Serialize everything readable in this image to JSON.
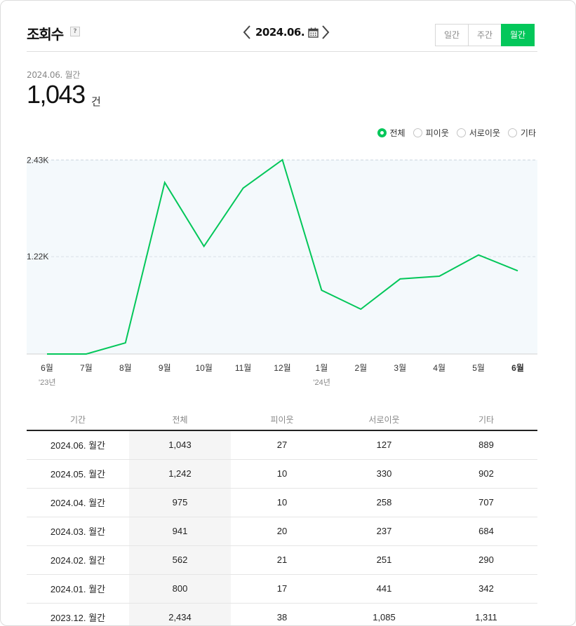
{
  "header": {
    "title": "조회수",
    "help_label": "?",
    "date_label": "2024.06.",
    "period_buttons": [
      "일간",
      "주간",
      "월간"
    ],
    "active_period": "월간"
  },
  "summary": {
    "subtitle": "2024.06. 월간",
    "value": "1,043",
    "unit": "건"
  },
  "legend": {
    "items": [
      "전체",
      "피이웃",
      "서로이웃",
      "기타"
    ],
    "selected": "전체"
  },
  "colors": {
    "accent": "#03c75a",
    "chart_fill": "#f4f9fc"
  },
  "chart_data": {
    "type": "line",
    "categories": [
      "6월",
      "7월",
      "8월",
      "9월",
      "10월",
      "11월",
      "12월",
      "1월",
      "2월",
      "3월",
      "4월",
      "5월",
      "6월"
    ],
    "year_labels": [
      {
        "index": 0,
        "label": "'23년"
      },
      {
        "index": 7,
        "label": "'24년"
      }
    ],
    "series": [
      {
        "values": [
          0,
          0,
          140,
          2150,
          1350,
          2080,
          2434,
          800,
          562,
          941,
          975,
          1242,
          1043
        ]
      }
    ],
    "yticks": [
      {
        "value": 1220,
        "label": "1.22K"
      },
      {
        "value": 2430,
        "label": "2.43K"
      }
    ],
    "ylim": [
      0,
      2434
    ],
    "highlight_last": true
  },
  "table": {
    "headers": [
      "기간",
      "전체",
      "피이웃",
      "서로이웃",
      "기타"
    ],
    "rows": [
      [
        "2024.06. 월간",
        "1,043",
        "27",
        "127",
        "889"
      ],
      [
        "2024.05. 월간",
        "1,242",
        "10",
        "330",
        "902"
      ],
      [
        "2024.04. 월간",
        "975",
        "10",
        "258",
        "707"
      ],
      [
        "2024.03. 월간",
        "941",
        "20",
        "237",
        "684"
      ],
      [
        "2024.02. 월간",
        "562",
        "21",
        "251",
        "290"
      ],
      [
        "2024.01. 월간",
        "800",
        "17",
        "441",
        "342"
      ],
      [
        "2023.12. 월간",
        "2,434",
        "38",
        "1,085",
        "1,311"
      ]
    ]
  }
}
